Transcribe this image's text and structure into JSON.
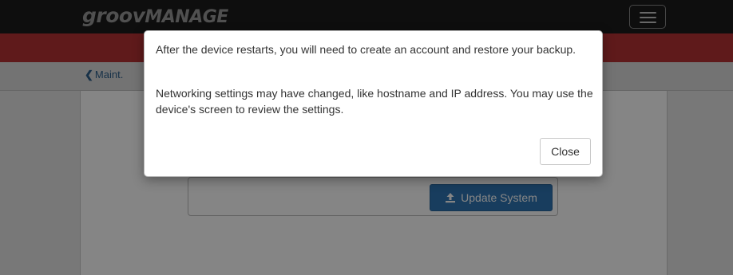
{
  "header": {
    "logo_part1": "groov",
    "logo_part2": "MANAGE",
    "menu_icon": "hamburger-menu-icon"
  },
  "subnav": {
    "back_icon": "chevron-left-icon",
    "back_label": "Maint."
  },
  "main": {
    "update_button": {
      "icon": "upload-icon",
      "label": "Update System"
    }
  },
  "modal": {
    "message_1": "After the device restarts, you will need to create an account and restore your backup.",
    "message_2": "Networking settings may have changed, like hostname and IP address. You may use the device's screen to review the settings.",
    "close_label": "Close"
  },
  "colors": {
    "topbar": "#1b1b1b",
    "redbar": "#b63234",
    "primary_button": "#2f76b4"
  }
}
